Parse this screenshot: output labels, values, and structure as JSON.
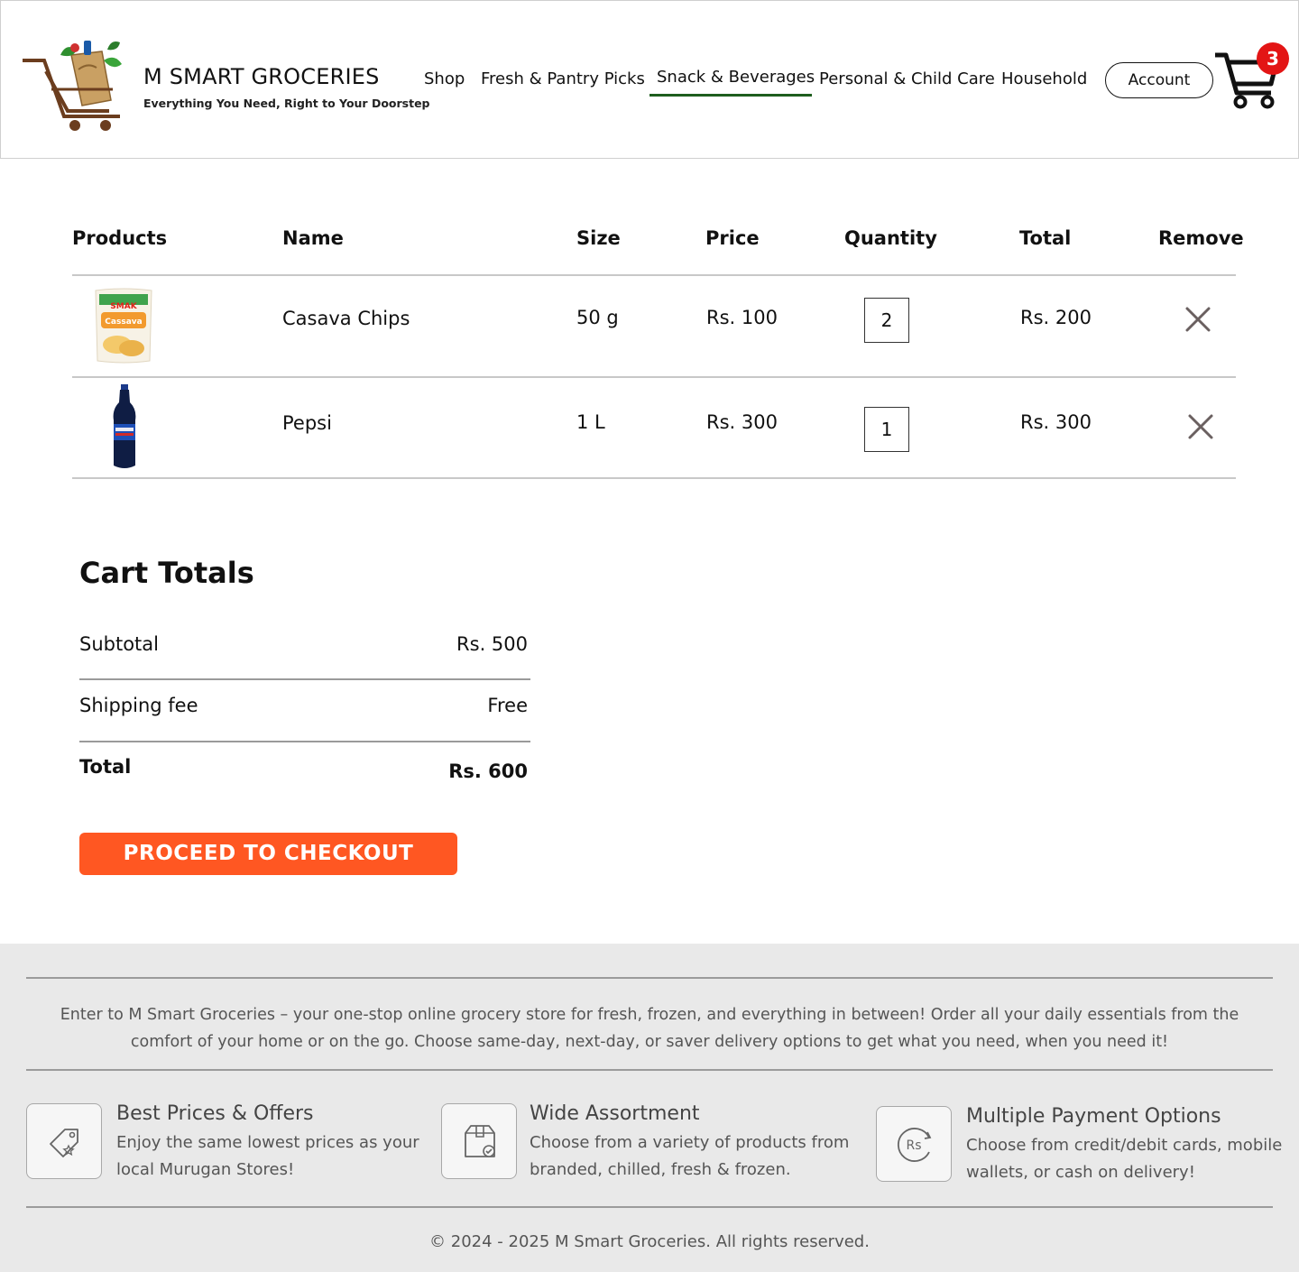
{
  "brand": {
    "name": "M SMART GROCERIES",
    "tagline": "Everything You Need, Right to Your Doorstep"
  },
  "nav": {
    "items": [
      {
        "label": "Shop"
      },
      {
        "label": "Fresh & Pantry Picks"
      },
      {
        "label": "Snack & Beverages",
        "active": true
      },
      {
        "label": "Personal & Child Care"
      },
      {
        "label": "Household"
      }
    ],
    "account_label": "Account",
    "cart_count": "3"
  },
  "cart_table": {
    "headers": [
      "Products",
      "Name",
      "Size",
      "Price",
      "Quantity",
      "Total",
      "Remove"
    ],
    "rows": [
      {
        "image": "casava-chips-pack",
        "name": "Casava Chips",
        "size": "50 g",
        "price": "Rs. 100",
        "quantity": "2",
        "total": "Rs. 200"
      },
      {
        "image": "pepsi-bottle",
        "name": "Pepsi",
        "size": "1 L",
        "price": "Rs. 300",
        "quantity": "1",
        "total": "Rs. 300"
      }
    ]
  },
  "cart_totals": {
    "title": "Cart Totals",
    "subtotal_label": "Subtotal",
    "subtotal_value": "Rs. 500",
    "shipping_label": "Shipping fee",
    "shipping_value": "Free",
    "total_label": "Total",
    "total_value": "Rs. 600",
    "checkout_label": "PROCEED TO CHECKOUT"
  },
  "footer": {
    "about": "Enter to M Smart Groceries – your one-stop online grocery store for fresh, frozen, and everything in between! Order all your daily essentials from the comfort of your home or on the go. Choose same-day, next-day, or saver delivery options to get what you need, when you need it!",
    "features": [
      {
        "icon": "price-tag-icon",
        "title": "Best Prices & Offers",
        "desc": "Enjoy the same lowest prices as your local Murugan Stores!"
      },
      {
        "icon": "package-icon",
        "title": "Wide Assortment",
        "desc": "Choose from a variety of products from branded, chilled, fresh & frozen."
      },
      {
        "icon": "rupee-payment-icon",
        "title": "Multiple Payment Options",
        "desc": "Choose from credit/debit cards, mobile wallets, or cash on delivery!"
      }
    ],
    "copyright": "© 2024 - 2025 M Smart Groceries. All rights reserved."
  },
  "colors": {
    "accent": "#ff5722",
    "nav_underline": "#1e5e1e",
    "badge": "#e31515",
    "footer_bg": "#e9e9e9"
  }
}
